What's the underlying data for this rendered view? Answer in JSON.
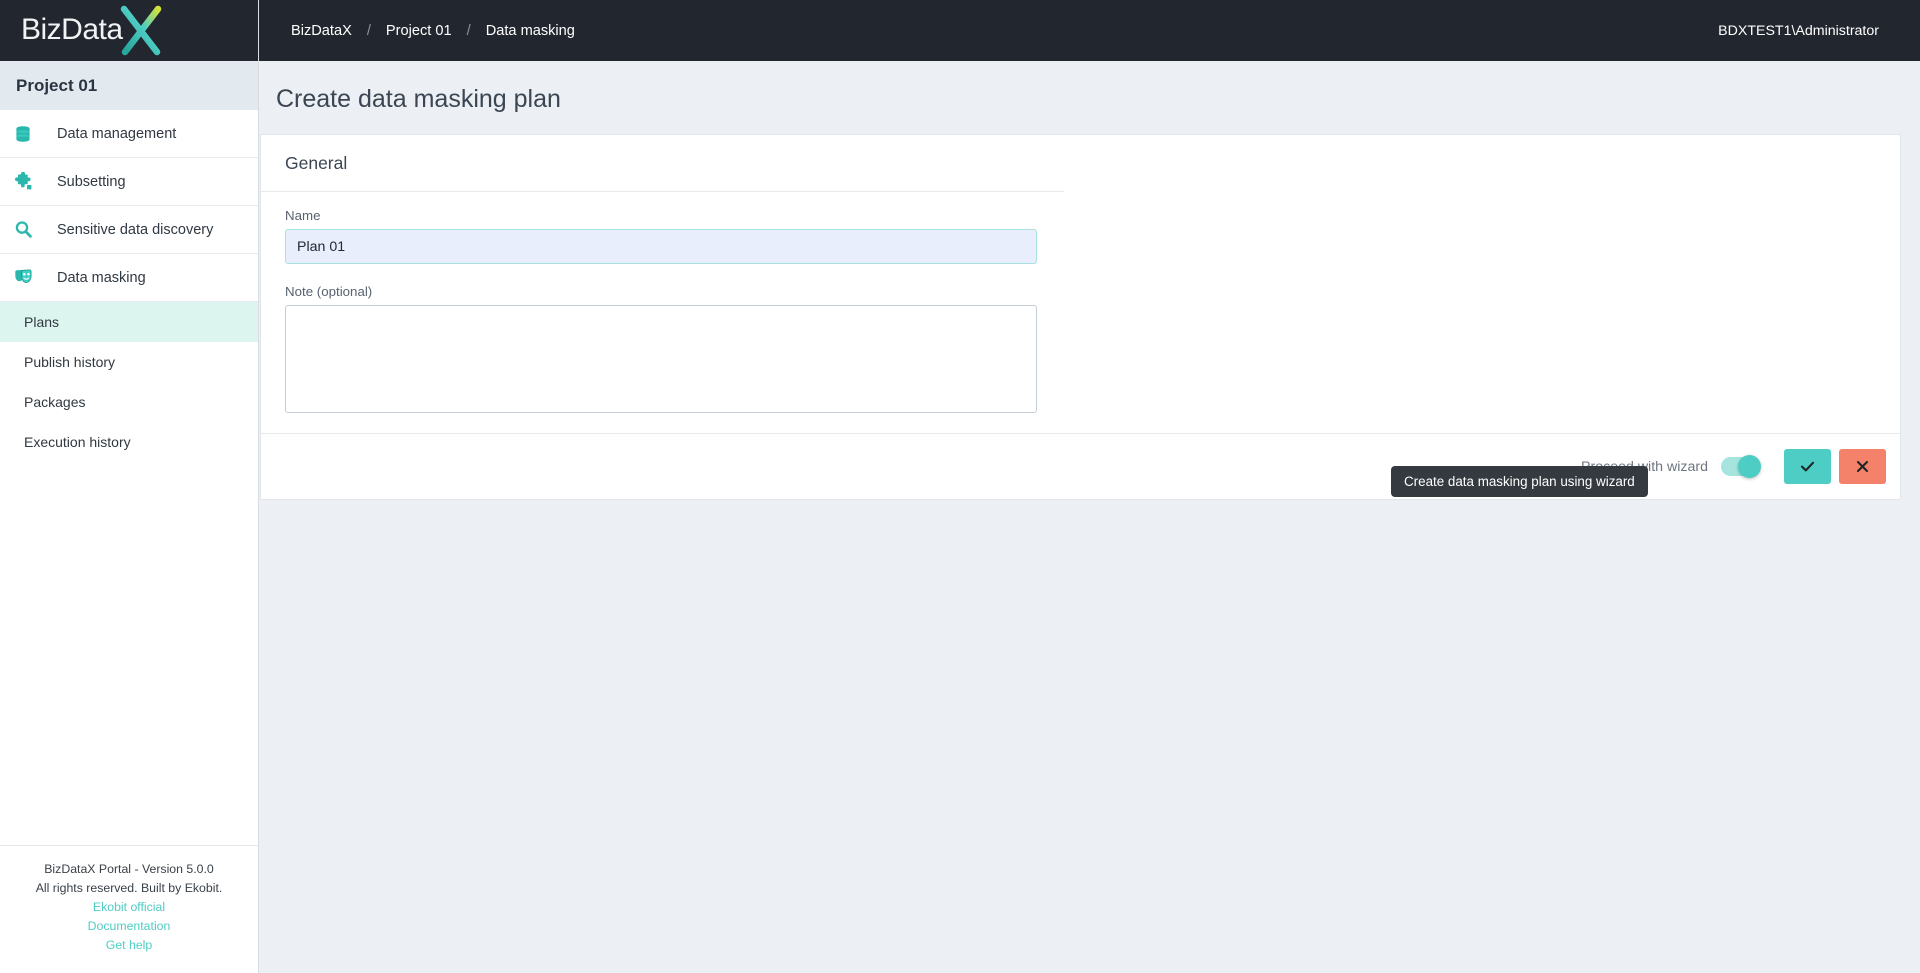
{
  "brand": {
    "logo_text_part1": "BizData",
    "logo_text_part2": "X",
    "accent_teal": "#4ecdc4",
    "accent_coral": "#f4816a",
    "dark_bg": "#22262f"
  },
  "topbar": {
    "breadcrumb": [
      {
        "label": "BizDataX"
      },
      {
        "label": "Project 01"
      },
      {
        "label": "Data masking"
      }
    ],
    "separator": "/",
    "user": "BDXTEST1\\Administrator"
  },
  "sidebar": {
    "project_name": "Project 01",
    "nav_items": [
      {
        "label": "Data management",
        "icon": "database-icon",
        "active": false
      },
      {
        "label": "Subsetting",
        "icon": "puzzle-piece-icon",
        "active": false
      },
      {
        "label": "Sensitive data discovery",
        "icon": "magnifier-icon",
        "active": false
      },
      {
        "label": "Data masking",
        "icon": "theater-masks-icon",
        "active": true
      }
    ],
    "sub_items": [
      {
        "label": "Plans",
        "active": true
      },
      {
        "label": "Publish history",
        "active": false
      },
      {
        "label": "Packages",
        "active": false
      },
      {
        "label": "Execution history",
        "active": false
      }
    ],
    "footer": {
      "version_line": "BizDataX Portal - Version 5.0.0",
      "rights_line": "All rights reserved. Built by Ekobit.",
      "links": [
        {
          "label": "Ekobit official"
        },
        {
          "label": "Documentation"
        },
        {
          "label": "Get help"
        }
      ]
    }
  },
  "main": {
    "page_title": "Create data masking plan",
    "card": {
      "section_title": "General",
      "fields": {
        "name": {
          "label": "Name",
          "value": "Plan 01",
          "placeholder": ""
        },
        "note": {
          "label": "Note (optional)",
          "value": "",
          "placeholder": ""
        }
      },
      "footer": {
        "wizard_toggle_label": "Proceed with wizard",
        "wizard_toggle_state": "on",
        "confirm_label": "✓",
        "cancel_label": "✕"
      }
    },
    "tooltip": "Create data masking plan using wizard"
  }
}
